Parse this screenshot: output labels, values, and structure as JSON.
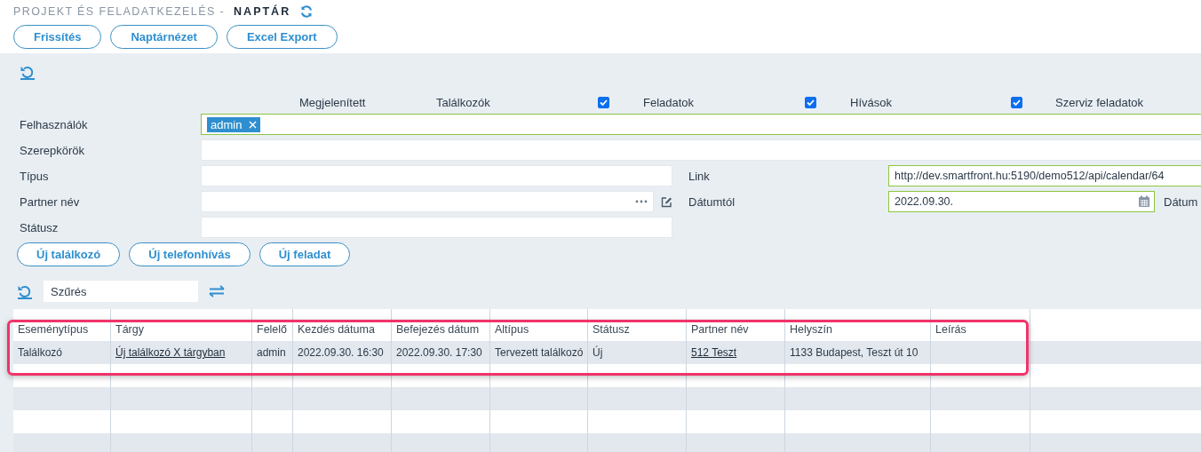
{
  "header": {
    "title_prefix": "PROJEKT ÉS FELADATKEZELÉS -",
    "title": "NAPTÁR",
    "buttons": [
      "Frissítés",
      "Naptárnézet",
      "Excel Export"
    ]
  },
  "filters": {
    "visible_label": "Megjelenített",
    "toggles": [
      {
        "label": "Találkozók",
        "checked": true
      },
      {
        "label": "Feladatok",
        "checked": true
      },
      {
        "label": "Hívások",
        "checked": true
      },
      {
        "label": "Szerviz feladatok"
      }
    ],
    "users": {
      "label": "Felhasználók",
      "tags": [
        "admin"
      ]
    },
    "roles": {
      "label": "Szerepkörök"
    },
    "type": {
      "label": "Típus"
    },
    "partner": {
      "label": "Partner név"
    },
    "status": {
      "label": "Státusz"
    },
    "link": {
      "label": "Link",
      "value": "http://dev.smartfront.hu:5190/demo512/api/calendar/64"
    },
    "date_from": {
      "label": "Dátumtól",
      "value": "2022.09.30."
    },
    "date_to": {
      "label": "Dátum"
    }
  },
  "actions": [
    "Új találkozó",
    "Új telefonhívás",
    "Új feladat"
  ],
  "table": {
    "filter": {
      "placeholder": "Szűrés"
    },
    "columns": [
      "Eseménytípus",
      "Tárgy",
      "Felelő",
      "Kezdés dátuma",
      "Befejezés dátum",
      "Altípus",
      "Státusz",
      "Partner név",
      "Helyszín",
      "Leírás"
    ],
    "rows": [
      {
        "cells": [
          {
            "kind": "text",
            "text": "Találkozó"
          },
          {
            "kind": "link",
            "text": "Új találkozó X tárgyban"
          },
          {
            "kind": "text",
            "text": "admin"
          },
          {
            "kind": "text",
            "text": "2022.09.30. 16:30"
          },
          {
            "kind": "text",
            "text": "2022.09.30. 17:30"
          },
          {
            "kind": "text",
            "text": "Tervezett találkozó"
          },
          {
            "kind": "text",
            "text": "Új"
          },
          {
            "kind": "link",
            "text": "512 Teszt"
          },
          {
            "kind": "text",
            "text": "1133 Budapest, Teszt út 10"
          }
        ]
      }
    ]
  }
}
